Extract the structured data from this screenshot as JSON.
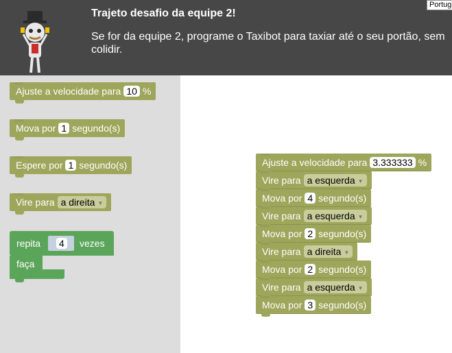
{
  "header": {
    "title": "Trajeto desafio da equipe 2!",
    "description": "Se for da equipe 2, programe o Taxibot para taxiar até o seu portão, sem colidir.",
    "language_selector": "Português"
  },
  "toolbox": {
    "set_speed": {
      "label": "Ajuste a velocidade para",
      "value": "10",
      "unit": "%"
    },
    "move": {
      "label": "Mova por",
      "value": "1",
      "unit": "segundo(s)"
    },
    "wait": {
      "label": "Espere por",
      "value": "1",
      "unit": "segundo(s)"
    },
    "turn": {
      "label": "Vire para",
      "value": "a direita"
    },
    "repeat": {
      "label": "repita",
      "value": "4",
      "unit": "vezes",
      "do_label": "faça"
    }
  },
  "workspace": {
    "set_speed": {
      "label": "Ajuste a velocidade para",
      "value": "3.333333",
      "unit": "%"
    },
    "program": [
      {
        "label": "Vire para",
        "value": "a esquerda"
      },
      {
        "label": "Mova por",
        "value": "4",
        "unit": "segundo(s)"
      },
      {
        "label": "Vire para",
        "value": "a esquerda"
      },
      {
        "label": "Mova por",
        "value": "2",
        "unit": "segundo(s)"
      },
      {
        "label": "Vire para",
        "value": "a direita"
      },
      {
        "label": "Mova por",
        "value": "2",
        "unit": "segundo(s)"
      },
      {
        "label": "Vire para",
        "value": "a esquerda"
      },
      {
        "label": "Mova por",
        "value": "3",
        "unit": "segundo(s)"
      }
    ]
  },
  "colors": {
    "header_bg": "#474747",
    "toolbox_bg": "#dddddd",
    "block_olive": "#9da65b",
    "block_loop": "#5ba55b"
  }
}
